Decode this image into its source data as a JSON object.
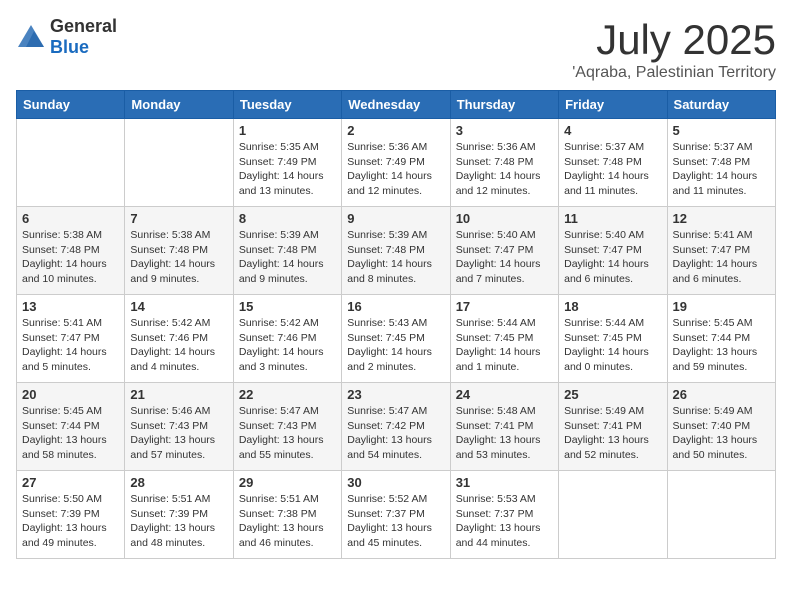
{
  "logo": {
    "text_general": "General",
    "text_blue": "Blue"
  },
  "title": "July 2025",
  "location": "'Aqraba, Palestinian Territory",
  "days_of_week": [
    "Sunday",
    "Monday",
    "Tuesday",
    "Wednesday",
    "Thursday",
    "Friday",
    "Saturday"
  ],
  "weeks": [
    [
      {
        "day": "",
        "sunrise": "",
        "sunset": "",
        "daylight": ""
      },
      {
        "day": "",
        "sunrise": "",
        "sunset": "",
        "daylight": ""
      },
      {
        "day": "1",
        "sunrise": "Sunrise: 5:35 AM",
        "sunset": "Sunset: 7:49 PM",
        "daylight": "Daylight: 14 hours and 13 minutes."
      },
      {
        "day": "2",
        "sunrise": "Sunrise: 5:36 AM",
        "sunset": "Sunset: 7:49 PM",
        "daylight": "Daylight: 14 hours and 12 minutes."
      },
      {
        "day": "3",
        "sunrise": "Sunrise: 5:36 AM",
        "sunset": "Sunset: 7:48 PM",
        "daylight": "Daylight: 14 hours and 12 minutes."
      },
      {
        "day": "4",
        "sunrise": "Sunrise: 5:37 AM",
        "sunset": "Sunset: 7:48 PM",
        "daylight": "Daylight: 14 hours and 11 minutes."
      },
      {
        "day": "5",
        "sunrise": "Sunrise: 5:37 AM",
        "sunset": "Sunset: 7:48 PM",
        "daylight": "Daylight: 14 hours and 11 minutes."
      }
    ],
    [
      {
        "day": "6",
        "sunrise": "Sunrise: 5:38 AM",
        "sunset": "Sunset: 7:48 PM",
        "daylight": "Daylight: 14 hours and 10 minutes."
      },
      {
        "day": "7",
        "sunrise": "Sunrise: 5:38 AM",
        "sunset": "Sunset: 7:48 PM",
        "daylight": "Daylight: 14 hours and 9 minutes."
      },
      {
        "day": "8",
        "sunrise": "Sunrise: 5:39 AM",
        "sunset": "Sunset: 7:48 PM",
        "daylight": "Daylight: 14 hours and 9 minutes."
      },
      {
        "day": "9",
        "sunrise": "Sunrise: 5:39 AM",
        "sunset": "Sunset: 7:48 PM",
        "daylight": "Daylight: 14 hours and 8 minutes."
      },
      {
        "day": "10",
        "sunrise": "Sunrise: 5:40 AM",
        "sunset": "Sunset: 7:47 PM",
        "daylight": "Daylight: 14 hours and 7 minutes."
      },
      {
        "day": "11",
        "sunrise": "Sunrise: 5:40 AM",
        "sunset": "Sunset: 7:47 PM",
        "daylight": "Daylight: 14 hours and 6 minutes."
      },
      {
        "day": "12",
        "sunrise": "Sunrise: 5:41 AM",
        "sunset": "Sunset: 7:47 PM",
        "daylight": "Daylight: 14 hours and 6 minutes."
      }
    ],
    [
      {
        "day": "13",
        "sunrise": "Sunrise: 5:41 AM",
        "sunset": "Sunset: 7:47 PM",
        "daylight": "Daylight: 14 hours and 5 minutes."
      },
      {
        "day": "14",
        "sunrise": "Sunrise: 5:42 AM",
        "sunset": "Sunset: 7:46 PM",
        "daylight": "Daylight: 14 hours and 4 minutes."
      },
      {
        "day": "15",
        "sunrise": "Sunrise: 5:42 AM",
        "sunset": "Sunset: 7:46 PM",
        "daylight": "Daylight: 14 hours and 3 minutes."
      },
      {
        "day": "16",
        "sunrise": "Sunrise: 5:43 AM",
        "sunset": "Sunset: 7:45 PM",
        "daylight": "Daylight: 14 hours and 2 minutes."
      },
      {
        "day": "17",
        "sunrise": "Sunrise: 5:44 AM",
        "sunset": "Sunset: 7:45 PM",
        "daylight": "Daylight: 14 hours and 1 minute."
      },
      {
        "day": "18",
        "sunrise": "Sunrise: 5:44 AM",
        "sunset": "Sunset: 7:45 PM",
        "daylight": "Daylight: 14 hours and 0 minutes."
      },
      {
        "day": "19",
        "sunrise": "Sunrise: 5:45 AM",
        "sunset": "Sunset: 7:44 PM",
        "daylight": "Daylight: 13 hours and 59 minutes."
      }
    ],
    [
      {
        "day": "20",
        "sunrise": "Sunrise: 5:45 AM",
        "sunset": "Sunset: 7:44 PM",
        "daylight": "Daylight: 13 hours and 58 minutes."
      },
      {
        "day": "21",
        "sunrise": "Sunrise: 5:46 AM",
        "sunset": "Sunset: 7:43 PM",
        "daylight": "Daylight: 13 hours and 57 minutes."
      },
      {
        "day": "22",
        "sunrise": "Sunrise: 5:47 AM",
        "sunset": "Sunset: 7:43 PM",
        "daylight": "Daylight: 13 hours and 55 minutes."
      },
      {
        "day": "23",
        "sunrise": "Sunrise: 5:47 AM",
        "sunset": "Sunset: 7:42 PM",
        "daylight": "Daylight: 13 hours and 54 minutes."
      },
      {
        "day": "24",
        "sunrise": "Sunrise: 5:48 AM",
        "sunset": "Sunset: 7:41 PM",
        "daylight": "Daylight: 13 hours and 53 minutes."
      },
      {
        "day": "25",
        "sunrise": "Sunrise: 5:49 AM",
        "sunset": "Sunset: 7:41 PM",
        "daylight": "Daylight: 13 hours and 52 minutes."
      },
      {
        "day": "26",
        "sunrise": "Sunrise: 5:49 AM",
        "sunset": "Sunset: 7:40 PM",
        "daylight": "Daylight: 13 hours and 50 minutes."
      }
    ],
    [
      {
        "day": "27",
        "sunrise": "Sunrise: 5:50 AM",
        "sunset": "Sunset: 7:39 PM",
        "daylight": "Daylight: 13 hours and 49 minutes."
      },
      {
        "day": "28",
        "sunrise": "Sunrise: 5:51 AM",
        "sunset": "Sunset: 7:39 PM",
        "daylight": "Daylight: 13 hours and 48 minutes."
      },
      {
        "day": "29",
        "sunrise": "Sunrise: 5:51 AM",
        "sunset": "Sunset: 7:38 PM",
        "daylight": "Daylight: 13 hours and 46 minutes."
      },
      {
        "day": "30",
        "sunrise": "Sunrise: 5:52 AM",
        "sunset": "Sunset: 7:37 PM",
        "daylight": "Daylight: 13 hours and 45 minutes."
      },
      {
        "day": "31",
        "sunrise": "Sunrise: 5:53 AM",
        "sunset": "Sunset: 7:37 PM",
        "daylight": "Daylight: 13 hours and 44 minutes."
      },
      {
        "day": "",
        "sunrise": "",
        "sunset": "",
        "daylight": ""
      },
      {
        "day": "",
        "sunrise": "",
        "sunset": "",
        "daylight": ""
      }
    ]
  ]
}
